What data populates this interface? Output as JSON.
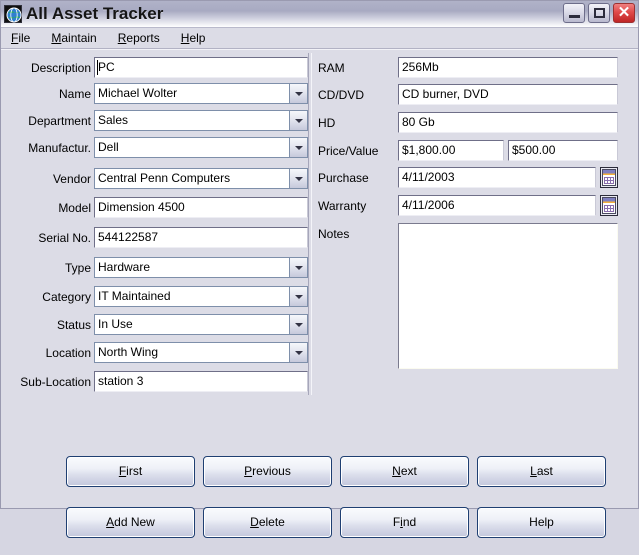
{
  "window": {
    "title": "All Asset Tracker",
    "icon": "globe-icon",
    "controls": {
      "minimize": "Minimize",
      "maximize": "Maximize",
      "close": "Close"
    }
  },
  "menubar": {
    "items": [
      {
        "label": "File",
        "accel": "F"
      },
      {
        "label": "Maintain",
        "accel": "M"
      },
      {
        "label": "Reports",
        "accel": "R"
      },
      {
        "label": "Help",
        "accel": "H"
      }
    ]
  },
  "form_left": {
    "fields": [
      {
        "label": "Description",
        "value": "PC",
        "type": "text",
        "focused": true
      },
      {
        "label": "Name",
        "value": "Michael Wolter",
        "type": "combo"
      },
      {
        "label": "Department",
        "value": "Sales",
        "type": "combo"
      },
      {
        "label": "Manufactur.",
        "value": "Dell",
        "type": "combo"
      },
      {
        "label": "Vendor",
        "value": "Central Penn Computers",
        "type": "combo"
      },
      {
        "label": "Model",
        "value": "Dimension 4500",
        "type": "text"
      },
      {
        "label": "Serial No.",
        "value": "544122587",
        "type": "text"
      },
      {
        "label": "Type",
        "value": "Hardware",
        "type": "combo"
      },
      {
        "label": "Category",
        "value": "IT Maintained",
        "type": "combo"
      },
      {
        "label": "Status",
        "value": "In Use",
        "type": "combo"
      },
      {
        "label": "Location",
        "value": "North Wing",
        "type": "combo"
      },
      {
        "label": "Sub-Location",
        "value": "station 3",
        "type": "text"
      }
    ]
  },
  "form_right": {
    "ram": {
      "label": "RAM",
      "value": "256Mb"
    },
    "cddvd": {
      "label": "CD/DVD",
      "value": "CD burner, DVD"
    },
    "hd": {
      "label": "HD",
      "value": "80 Gb"
    },
    "price": {
      "label": "Price/Value",
      "value": "$1,800.00",
      "value2": "$500.00"
    },
    "purchase": {
      "label": "Purchase",
      "value": "4/11/2003",
      "picker": "calendar-icon"
    },
    "warranty": {
      "label": "Warranty",
      "value": "4/11/2006",
      "picker": "calendar-icon"
    },
    "notes": {
      "label": "Notes",
      "value": ""
    }
  },
  "buttons": [
    {
      "label": "First",
      "accel": "F"
    },
    {
      "label": "Previous",
      "accel": "P"
    },
    {
      "label": "Next",
      "accel": "N"
    },
    {
      "label": "Last",
      "accel": "L"
    },
    {
      "label": "Add New",
      "accel": "A"
    },
    {
      "label": "Delete",
      "accel": "D"
    },
    {
      "label": "Find",
      "accel": "i"
    },
    {
      "label": "Help",
      "accel": ""
    }
  ],
  "colors": {
    "window_bg": "#dcdce6",
    "titlebar_top": "#b0b2c8",
    "button_border": "#1f3f72",
    "close_button": "#e04a4a"
  }
}
